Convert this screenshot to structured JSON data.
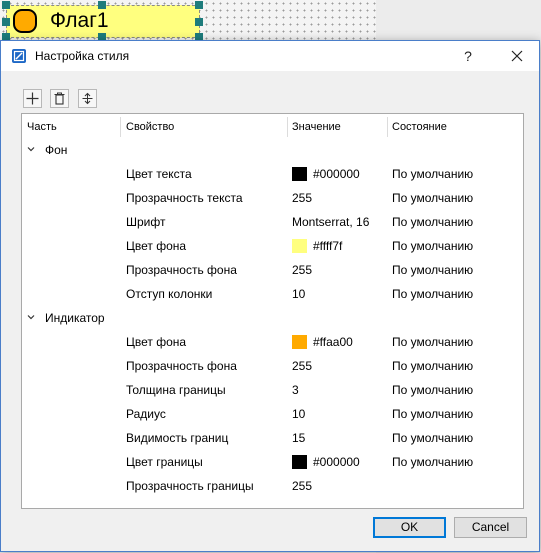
{
  "widget": {
    "label": "Флаг1"
  },
  "dialog": {
    "title": "Настройка стиля",
    "help_glyph": "?",
    "close_icon": "close-icon"
  },
  "toolbar": {
    "buttons": [
      "add-icon",
      "delete-icon",
      "move-icon"
    ]
  },
  "table": {
    "columns": [
      "Часть",
      "Свойство",
      "Значение",
      "Состояние"
    ],
    "groups": [
      {
        "part": "Фон",
        "rows": [
          {
            "property": "Цвет текста",
            "value": "#000000",
            "swatch": "#000000",
            "state": "По умолчанию"
          },
          {
            "property": "Прозрачность текста",
            "value": "255",
            "state": "По умолчанию"
          },
          {
            "property": "Шрифт",
            "value": "Montserrat, 16",
            "state": "По умолчанию"
          },
          {
            "property": "Цвет фона",
            "value": "#ffff7f",
            "swatch": "#ffff7f",
            "state": "По умолчанию"
          },
          {
            "property": "Прозрачность фона",
            "value": "255",
            "state": "По умолчанию"
          },
          {
            "property": "Отступ колонки",
            "value": "10",
            "state": "По умолчанию"
          }
        ]
      },
      {
        "part": "Индикатор",
        "rows": [
          {
            "property": "Цвет фона",
            "value": "#ffaa00",
            "swatch": "#ffaa00",
            "state": "По умолчанию"
          },
          {
            "property": "Прозрачность фона",
            "value": "255",
            "state": "По умолчанию"
          },
          {
            "property": "Толщина границы",
            "value": "3",
            "state": "По умолчанию"
          },
          {
            "property": "Радиус",
            "value": "10",
            "state": "По умолчанию"
          },
          {
            "property": "Видимость границ",
            "value": "15",
            "state": "По умолчанию"
          },
          {
            "property": "Цвет границы",
            "value": "#000000",
            "swatch": "#000000",
            "state": "По умолчанию"
          },
          {
            "property": "Прозрачность границы",
            "value": "255",
            "state": ""
          }
        ]
      }
    ]
  },
  "footer": {
    "ok_label": "OK",
    "cancel_label": "Cancel"
  },
  "colors": {
    "accent": "#0078d7",
    "title_icon": "#1e68c6",
    "selection_handle": "#1e7c7c"
  }
}
